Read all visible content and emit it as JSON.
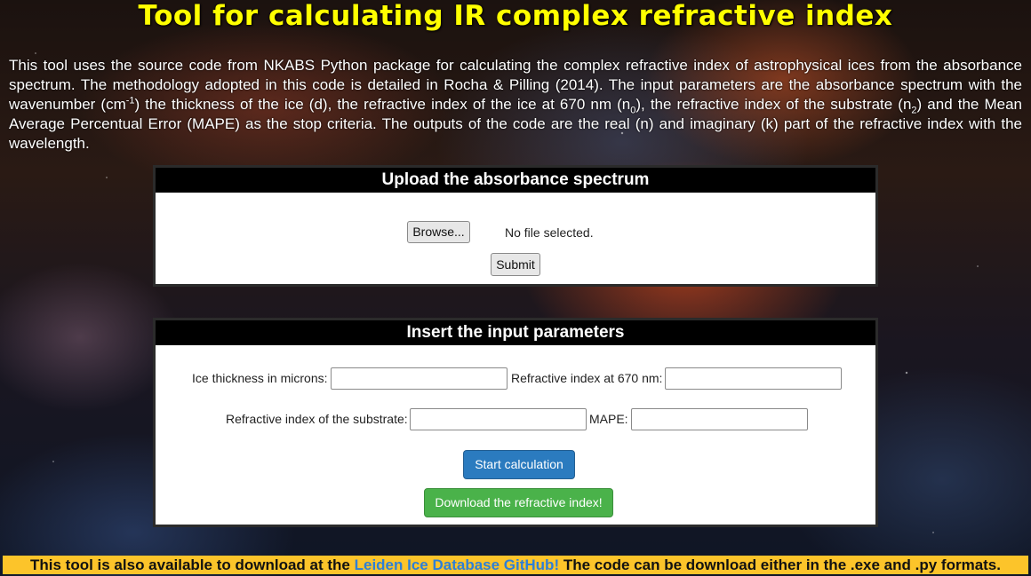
{
  "title": "Tool for calculating IR complex refractive index",
  "intro": {
    "part1": "This tool uses the source code from NKABS Python package for calculating the complex refractive index of astrophysical ices from the absorbance spectrum. The methodology adopted in this code is detailed in Rocha & Pilling (2014). The input parameters are the absorbance spectrum with the wavenumber (cm",
    "sup1": "-1",
    "part2": ") the thickness of the ice (d), the refractive index of the ice at 670 nm (n",
    "sub0": "0",
    "part3": "), the refractive index of the substrate (n",
    "sub2": "2",
    "part4": ") and the Mean Average Percentual Error (MAPE) as the stop criteria. The outputs of the code are the real (n) and imaginary (k) part of the refractive index with the wavelength."
  },
  "upload": {
    "heading": "Upload the absorbance spectrum",
    "browse_label": "Browse...",
    "file_status": "No file selected.",
    "submit_label": "Submit"
  },
  "params": {
    "heading": "Insert the input parameters",
    "thickness_label": "Ice thickness in microns:",
    "thickness_value": "",
    "refr670_label": "Refractive index at 670 nm:",
    "refr670_value": "",
    "substrate_label": "Refractive index of the substrate:",
    "substrate_value": "",
    "mape_label": "MAPE:",
    "mape_value": "",
    "start_label": "Start calculation",
    "download_label": "Download the refractive index!"
  },
  "footer": {
    "pre": "This tool is also available to download at the ",
    "link": "Leiden Ice Database GitHub!",
    "post": " The code can be download either in the .exe and .py formats."
  },
  "colors": {
    "title": "#ffff00",
    "footer_bg": "#fcc42a",
    "link": "#2e7fd6",
    "primary_button": "#2b7bbf",
    "success_button": "#4ab24a"
  }
}
